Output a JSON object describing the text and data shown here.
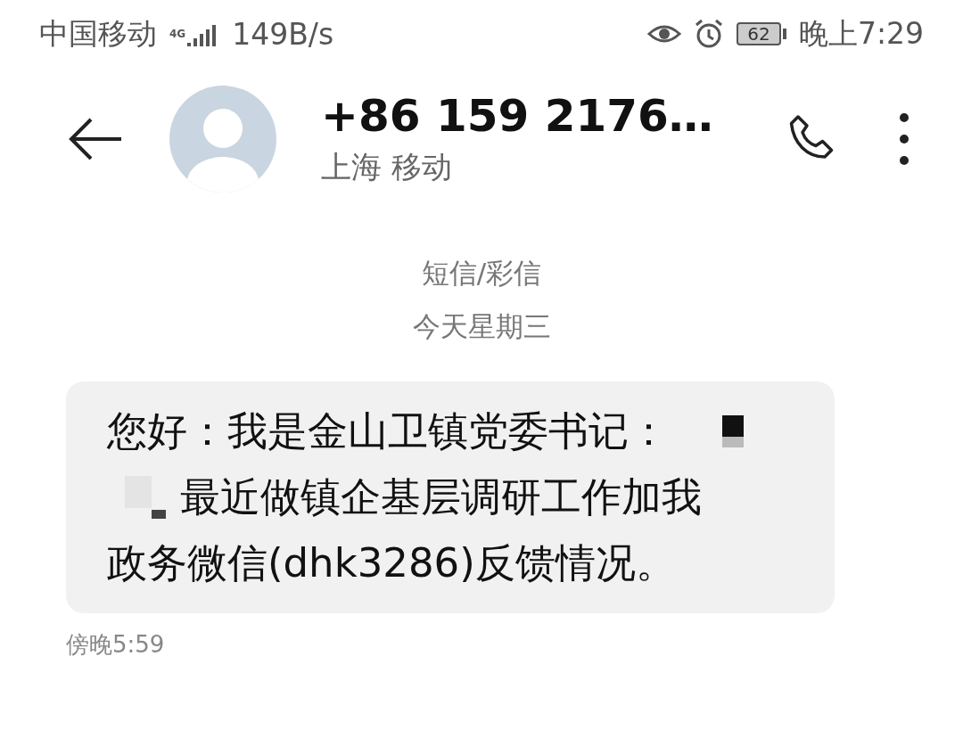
{
  "status_bar": {
    "carrier": "中国移动",
    "network": "4G",
    "speed": "149B/s",
    "battery": "62",
    "time": "晚上7:29"
  },
  "header": {
    "title": "+86 159 2176…",
    "subtitle": "上海 移动"
  },
  "thread": {
    "channel": "短信/彩信",
    "date": "今天星期三"
  },
  "messages": [
    {
      "lines": [
        {
          "text": "您好：我是金山卫镇党委书记：",
          "redacted_after": true,
          "redacted_before": false
        },
        {
          "text": "最近做镇企基层调研工作加我",
          "redacted_after": false,
          "redacted_before": true
        },
        {
          "text": "政务微信(dhk3286)反馈情况。",
          "redacted_after": false,
          "redacted_before": false
        }
      ],
      "time": "傍晚5:59"
    }
  ]
}
